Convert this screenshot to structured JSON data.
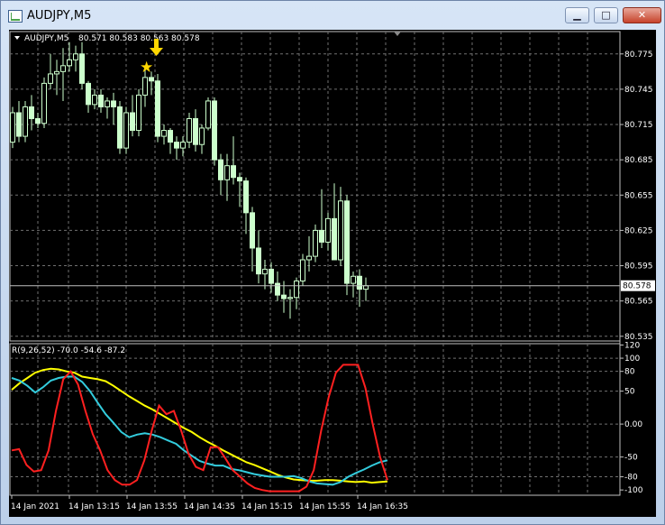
{
  "window": {
    "title": "AUDJPY,M5",
    "buttons": {
      "minimize": "▁",
      "maximize": "□",
      "close": "✕"
    }
  },
  "chart_data": [
    {
      "type": "candlestick",
      "symbol_label": "AUDJPY,M5",
      "ohlc_label": "80.571 80.583 80.563 80.578",
      "y_ticks": [
        "80.775",
        "80.745",
        "80.715",
        "80.685",
        "80.655",
        "80.625",
        "80.595",
        "80.565",
        "80.535"
      ],
      "ylim": [
        80.531,
        80.794
      ],
      "current_price": 80.578,
      "current_price_label": "80.578",
      "candle_color": "#ccffcc",
      "candles": [
        [
          80.7,
          80.73,
          80.695,
          80.725
        ],
        [
          80.725,
          80.735,
          80.7,
          80.705
        ],
        [
          80.705,
          80.735,
          80.7,
          80.73
        ],
        [
          80.73,
          80.74,
          80.71,
          80.72
        ],
        [
          80.72,
          80.725,
          80.712,
          80.716
        ],
        [
          80.716,
          80.755,
          80.712,
          80.75
        ],
        [
          80.75,
          80.775,
          80.745,
          80.758
        ],
        [
          80.758,
          80.77,
          80.74,
          80.76
        ],
        [
          80.76,
          80.78,
          80.735,
          80.765
        ],
        [
          80.765,
          80.785,
          80.76,
          80.77
        ],
        [
          80.77,
          80.782,
          80.76,
          80.775
        ],
        [
          80.775,
          80.785,
          80.745,
          80.75
        ],
        [
          80.75,
          80.752,
          80.725,
          80.732
        ],
        [
          80.732,
          80.745,
          80.728,
          80.74
        ],
        [
          80.74,
          80.745,
          80.725,
          80.73
        ],
        [
          80.73,
          80.738,
          80.72,
          80.735
        ],
        [
          80.735,
          80.742,
          80.715,
          80.73
        ],
        [
          80.73,
          80.735,
          80.69,
          80.695
        ],
        [
          80.695,
          80.73,
          80.69,
          80.725
        ],
        [
          80.725,
          80.74,
          80.705,
          80.71
        ],
        [
          80.71,
          80.745,
          80.705,
          80.74
        ],
        [
          80.74,
          80.762,
          80.73,
          80.755
        ],
        [
          80.755,
          80.76,
          80.74,
          80.752
        ],
        [
          80.752,
          80.758,
          80.7,
          80.705
        ],
        [
          80.705,
          80.715,
          80.698,
          80.71
        ],
        [
          80.71,
          80.712,
          80.69,
          80.7
        ],
        [
          80.7,
          80.705,
          80.685,
          80.695
        ],
        [
          80.695,
          80.705,
          80.688,
          80.7
        ],
        [
          80.7,
          80.725,
          80.695,
          80.72
        ],
        [
          80.72,
          80.728,
          80.692,
          80.698
        ],
        [
          80.698,
          80.715,
          80.69,
          80.712
        ],
        [
          80.712,
          80.738,
          80.71,
          80.735
        ],
        [
          80.735,
          80.738,
          80.68,
          80.685
        ],
        [
          80.685,
          80.69,
          80.655,
          80.668
        ],
        [
          80.668,
          80.69,
          80.65,
          80.68
        ],
        [
          80.68,
          80.705,
          80.664,
          80.67
        ],
        [
          80.67,
          80.674,
          80.645,
          80.667
        ],
        [
          80.667,
          80.67,
          80.622,
          80.64
        ],
        [
          80.64,
          80.645,
          80.59,
          80.61
        ],
        [
          80.61,
          80.625,
          80.58,
          80.588
        ],
        [
          80.588,
          80.6,
          80.575,
          80.592
        ],
        [
          80.592,
          80.598,
          80.572,
          80.58
        ],
        [
          80.58,
          80.59,
          80.565,
          80.57
        ],
        [
          80.57,
          80.582,
          80.555,
          80.567
        ],
        [
          80.567,
          80.575,
          80.55,
          80.568
        ],
        [
          80.568,
          80.585,
          80.558,
          80.582
        ],
        [
          80.582,
          80.605,
          80.578,
          80.6
        ],
        [
          80.6,
          80.62,
          80.59,
          80.603
        ],
        [
          80.603,
          80.63,
          80.598,
          80.625
        ],
        [
          80.625,
          80.66,
          80.61,
          80.615
        ],
        [
          80.615,
          80.64,
          80.608,
          80.635
        ],
        [
          80.635,
          80.665,
          80.62,
          80.6
        ],
        [
          80.6,
          80.662,
          80.595,
          80.65
        ],
        [
          80.65,
          80.655,
          80.57,
          80.58
        ],
        [
          80.58,
          80.59,
          80.568,
          80.586
        ],
        [
          80.586,
          80.592,
          80.56,
          80.575
        ],
        [
          80.575,
          80.585,
          80.565,
          80.578
        ]
      ]
    },
    {
      "type": "line",
      "indicator_label": "R(9,26,52) -70.0 -54.6 -87.2",
      "y_ticks": [
        "120",
        "100",
        "80",
        "50",
        "0.00",
        "-50",
        "-80",
        "-100"
      ],
      "ylim": [
        -108,
        122
      ],
      "series": [
        {
          "color": "#ffff00",
          "values": [
            52,
            62,
            70,
            78,
            82,
            84,
            83,
            80,
            78,
            72,
            70,
            68,
            65,
            58,
            50,
            42,
            35,
            28,
            22,
            15,
            8,
            1,
            -6,
            -12,
            -20,
            -27,
            -33,
            -40,
            -46,
            -52,
            -58,
            -62,
            -67,
            -72,
            -77,
            -81,
            -84,
            -85,
            -86,
            -86,
            -85,
            -85,
            -86,
            -87,
            -88,
            -87,
            -89,
            -88,
            -87
          ]
        },
        {
          "color": "#33ccdd",
          "values": [
            70,
            66,
            58,
            48,
            56,
            66,
            70,
            72,
            72,
            64,
            50,
            32,
            15,
            2,
            -12,
            -20,
            -16,
            -14,
            -16,
            -20,
            -25,
            -30,
            -40,
            -48,
            -56,
            -60,
            -63,
            -63,
            -68,
            -70,
            -73,
            -76,
            -78,
            -80,
            -80,
            -80,
            -79,
            -82,
            -87,
            -90,
            -91,
            -92,
            -88,
            -80,
            -74,
            -69,
            -63,
            -58,
            -55
          ]
        },
        {
          "color": "#ff2020",
          "values": [
            -40,
            -38,
            -62,
            -72,
            -70,
            -40,
            20,
            68,
            80,
            60,
            20,
            -15,
            -40,
            -70,
            -85,
            -92,
            -92,
            -85,
            -55,
            -10,
            28,
            15,
            20,
            -10,
            -45,
            -65,
            -70,
            -35,
            -35,
            -52,
            -70,
            -80,
            -90,
            -97,
            -100,
            -102,
            -102,
            -102,
            -102,
            -102,
            -95,
            -70,
            -10,
            40,
            78,
            90,
            90,
            90,
            55,
            0,
            -50,
            -85
          ]
        }
      ]
    }
  ],
  "x_labels": [
    "14 Jan 2021",
    "14 Jan 13:15",
    "14 Jan 13:55",
    "14 Jan 14:35",
    "14 Jan 15:15",
    "14 Jan 15:55",
    "14 Jan 16:35"
  ],
  "marker_arrow_color": "#ffd700"
}
